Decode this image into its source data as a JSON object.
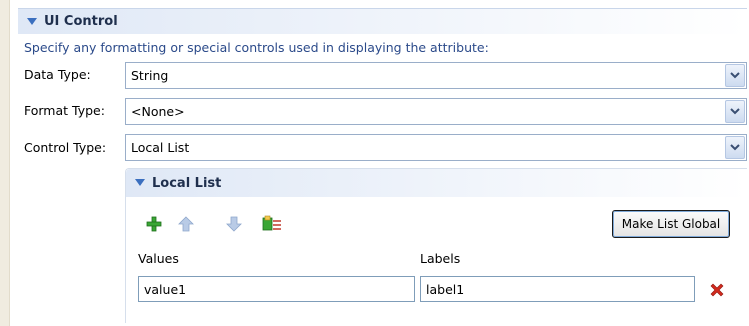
{
  "section": {
    "title": "UI Control",
    "description": "Specify any formatting or special controls used in displaying the attribute:"
  },
  "fields": {
    "data_type": {
      "label": "Data Type:",
      "value": "String"
    },
    "format_type": {
      "label": "Format Type:",
      "value": "<None>"
    },
    "control_type": {
      "label": "Control Type:",
      "value": "Local List"
    }
  },
  "local_list": {
    "title": "Local List",
    "toolbar": {
      "add_icon": "plus-icon",
      "move_up_icon": "arrow-up-icon",
      "move_down_icon": "arrow-down-icon",
      "edit_icon": "edit-list-icon"
    },
    "make_global_label": "Make List Global",
    "columns": {
      "values": "Values",
      "labels": "Labels"
    },
    "rows": [
      {
        "value": "value1",
        "label": "label1"
      }
    ],
    "delete_icon": "delete-x-icon"
  },
  "colors": {
    "header_gradient_start": "#dfe8f6",
    "description_text": "#2b4a8a",
    "add_green": "#3aa635",
    "delete_red": "#d22a1e"
  }
}
